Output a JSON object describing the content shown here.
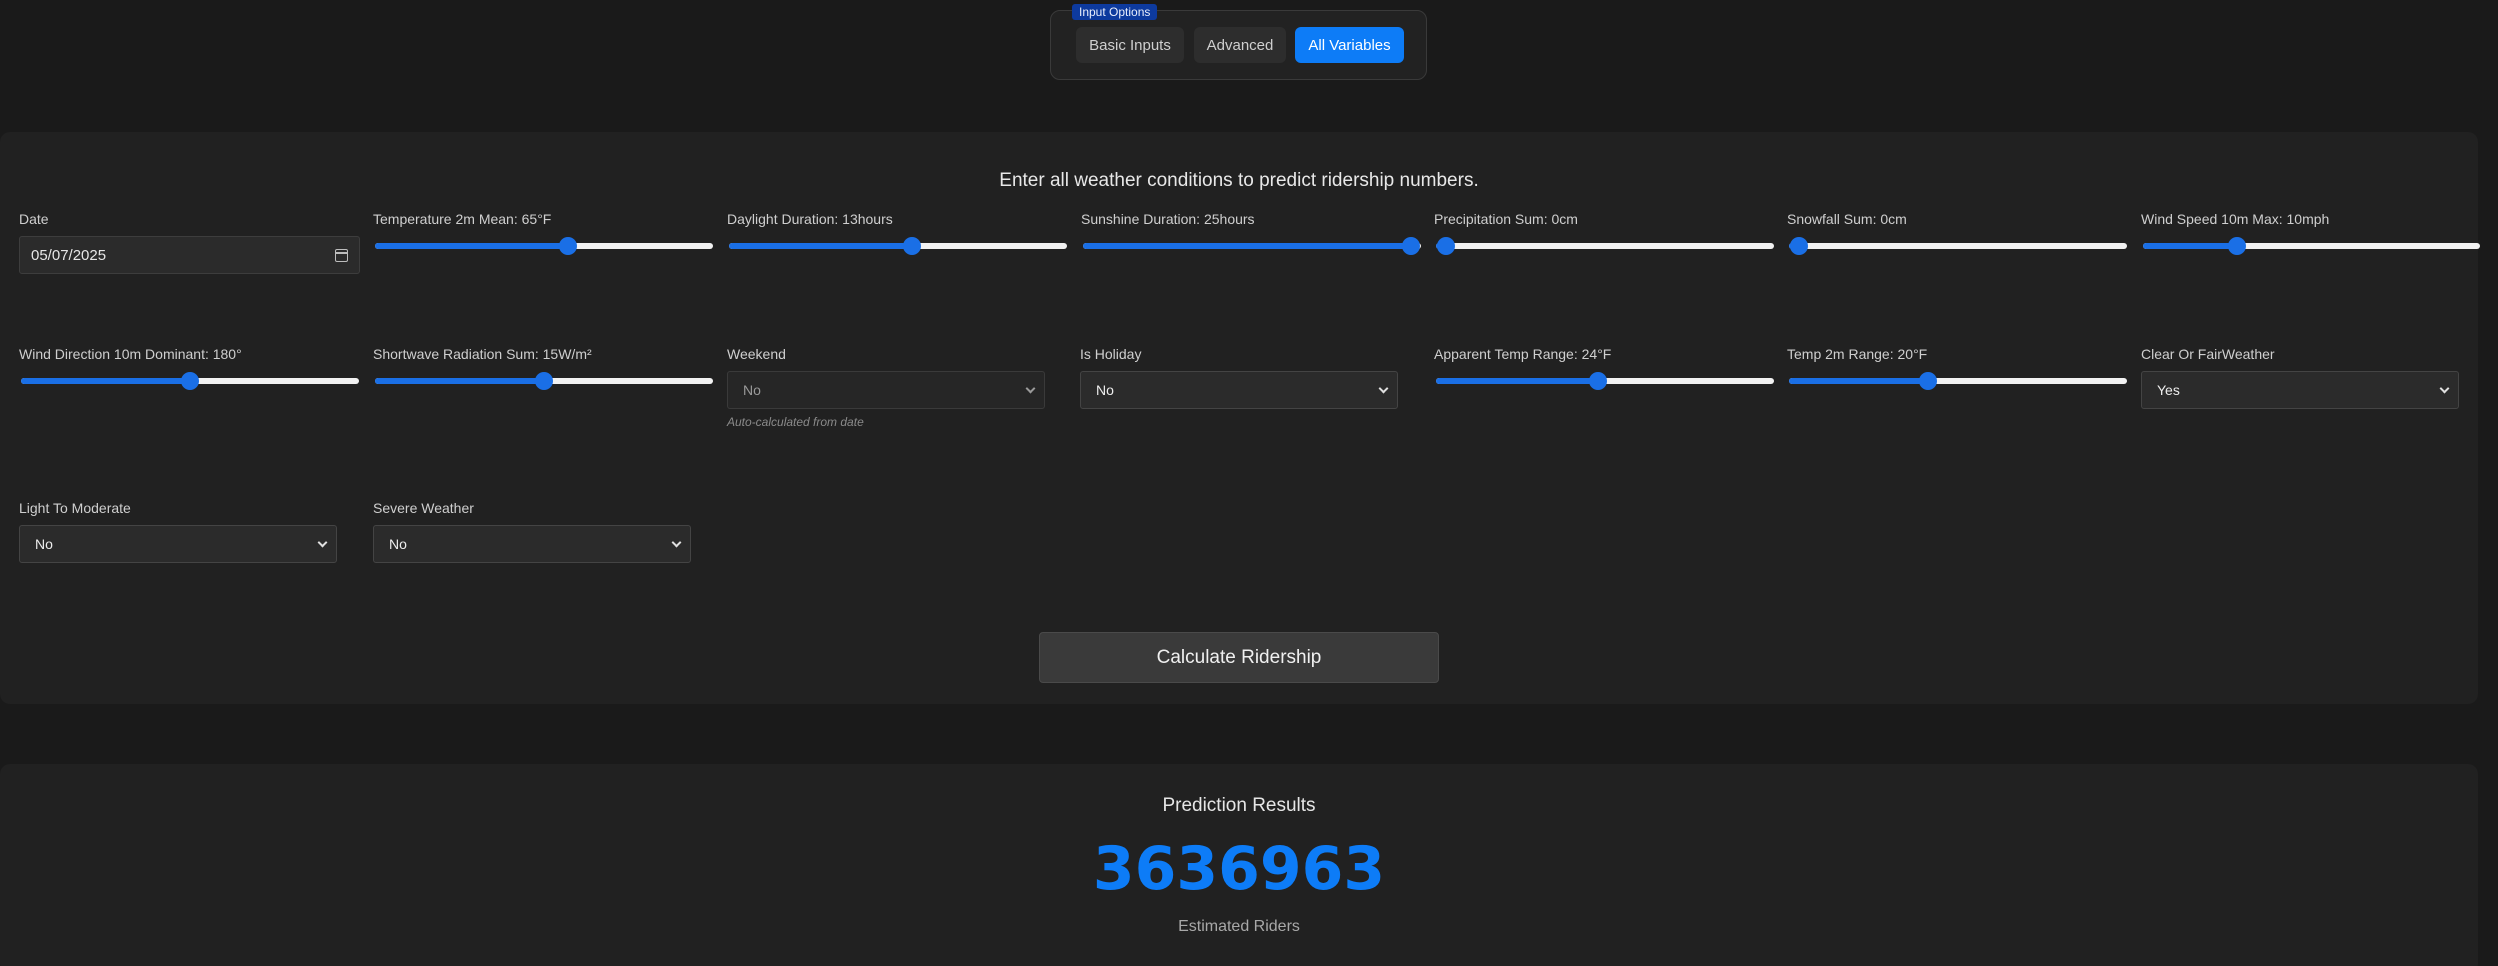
{
  "mode_group": {
    "legend": "Input Options",
    "buttons": [
      "Basic Inputs",
      "Advanced",
      "All Variables"
    ],
    "active": "All Variables"
  },
  "form": {
    "intro": "Enter all weather conditions to predict ridership numbers.",
    "date": {
      "label": "Date",
      "value": "05/07/2025"
    },
    "temperature": {
      "label": "Temperature 2m Mean: 65°F",
      "level": 0.57
    },
    "daylight": {
      "label": "Daylight Duration: 13hours",
      "level": 0.54
    },
    "sunshine": {
      "label": "Sunshine Duration: 25hours",
      "level": 0.97
    },
    "precipitation": {
      "label": "Precipitation Sum: 0cm",
      "level": 0.03
    },
    "snowfall": {
      "label": "Snowfall Sum: 0cm",
      "level": 0.03
    },
    "wind_speed": {
      "label": "Wind Speed 10m Max: 10mph",
      "level": 0.28
    },
    "wind_direction": {
      "label": "Wind Direction 10m Dominant: 180°",
      "level": 0.5
    },
    "shortwave": {
      "label": "Shortwave Radiation Sum: 15W/m²",
      "level": 0.5
    },
    "weekend": {
      "label": "Weekend",
      "value": "No",
      "hint": "Auto-calculated from date"
    },
    "holiday": {
      "label": "Is Holiday",
      "value": "No"
    },
    "apparent_range": {
      "label": "Apparent Temp Range: 24°F",
      "level": 0.48
    },
    "temp_range": {
      "label": "Temp 2m Range: 20°F",
      "level": 0.41
    },
    "clear_fair": {
      "label": "Clear Or FairWeather",
      "value": "Yes"
    },
    "light_moderate": {
      "label": "Light To Moderate",
      "value": "No"
    },
    "severe": {
      "label": "Severe Weather",
      "value": "No"
    },
    "submit": "Calculate Ridership"
  },
  "results": {
    "title": "Prediction Results",
    "value": "3636963",
    "subtitle": "Estimated Riders"
  },
  "colors": {
    "accent": "#0d7cf7",
    "background": "#1a1a1a",
    "panel": "#212121"
  },
  "icons": [
    "calendar-icon",
    "chevron-down-icon"
  ]
}
